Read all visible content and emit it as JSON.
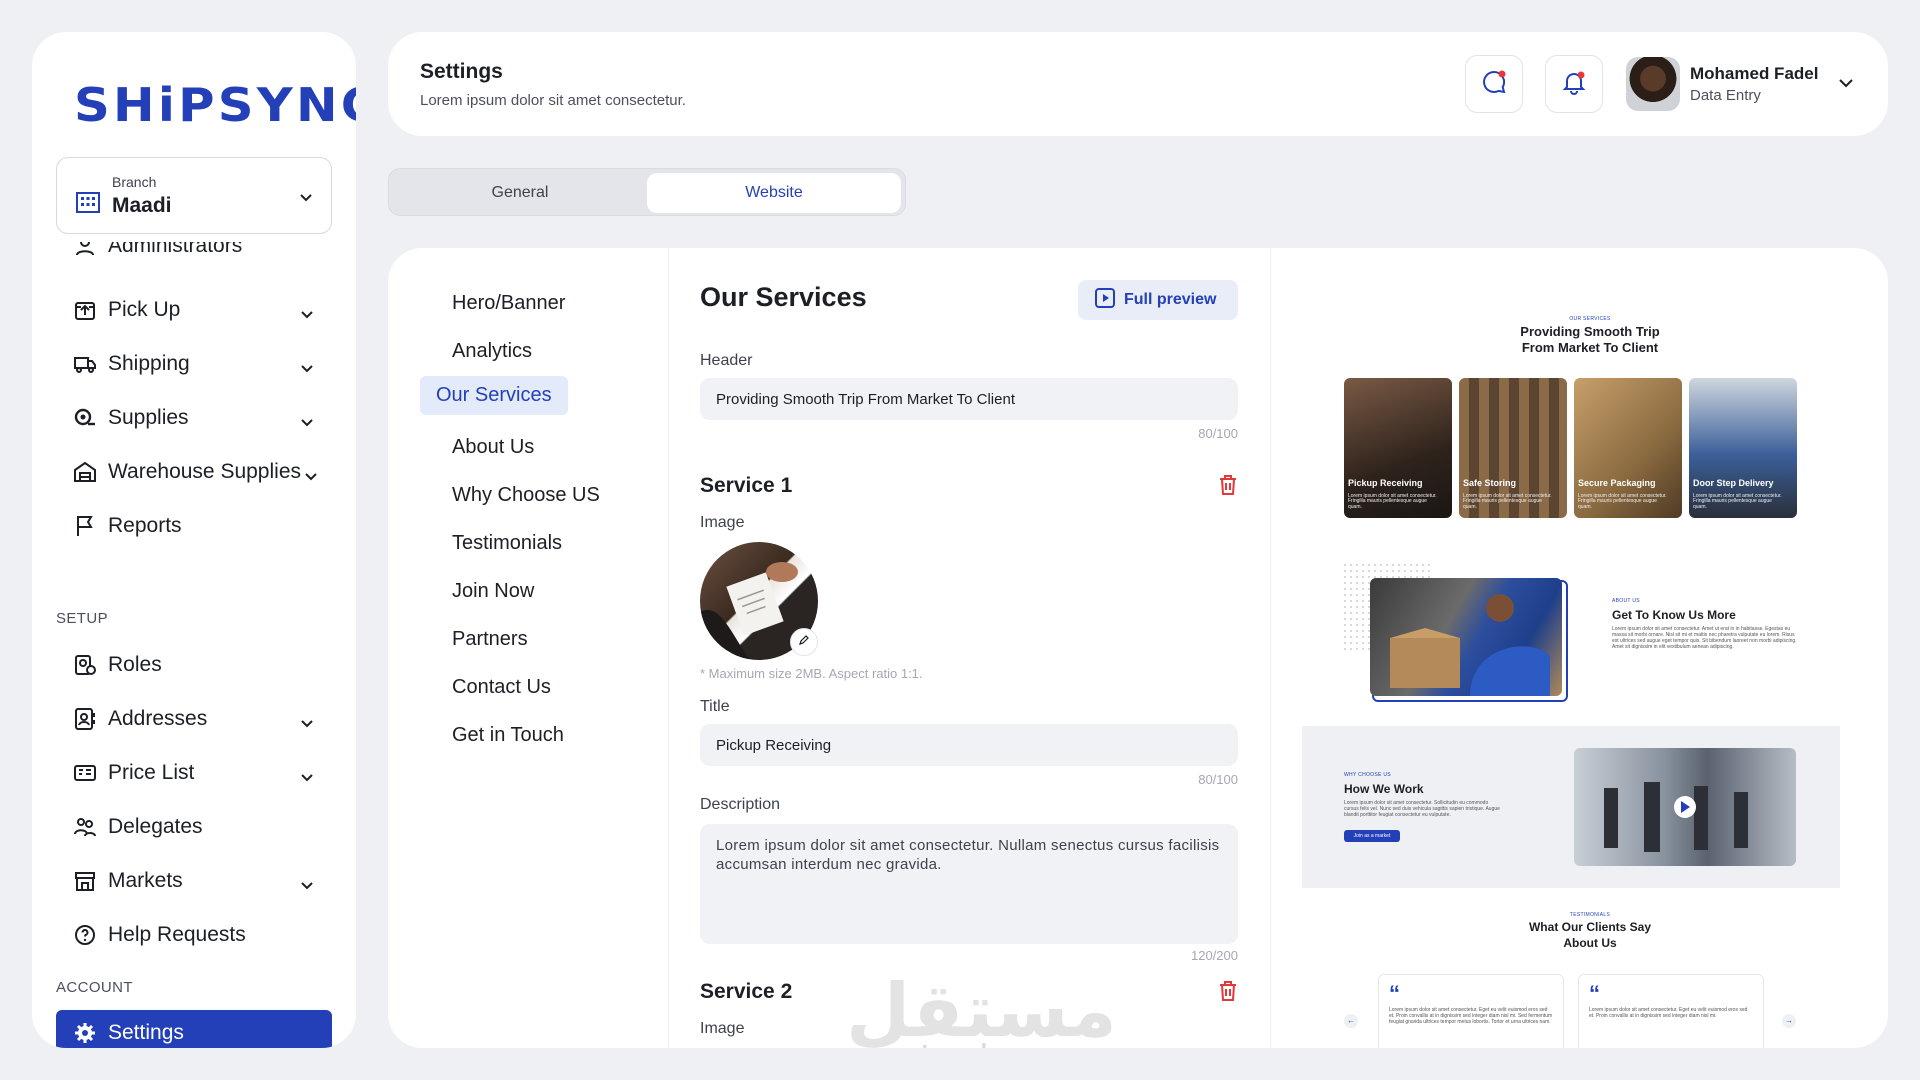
{
  "brand": {
    "logo": "SHiPSYNC",
    "accent": "#2440b8"
  },
  "branch": {
    "label": "Branch",
    "value": "Maadi"
  },
  "sidebar": {
    "partial_item": "Administrators",
    "items": [
      {
        "label": "Pick Up",
        "icon": "pickup-icon",
        "chevron": true
      },
      {
        "label": "Shipping",
        "icon": "truck-icon",
        "chevron": true
      },
      {
        "label": "Supplies",
        "icon": "supplies-icon",
        "chevron": true
      },
      {
        "label": "Warehouse Supplies",
        "icon": "warehouse-icon",
        "chevron": true
      },
      {
        "label": "Reports",
        "icon": "flag-icon",
        "chevron": false
      }
    ],
    "setup_label": "SETUP",
    "setup_items": [
      {
        "label": "Roles",
        "icon": "roles-icon",
        "chevron": false
      },
      {
        "label": "Addresses",
        "icon": "addresses-icon",
        "chevron": true
      },
      {
        "label": "Price List",
        "icon": "price-list-icon",
        "chevron": true
      },
      {
        "label": "Delegates",
        "icon": "delegates-icon",
        "chevron": false
      },
      {
        "label": "Markets",
        "icon": "markets-icon",
        "chevron": true
      },
      {
        "label": "Help Requests",
        "icon": "help-icon",
        "chevron": false
      }
    ],
    "account_label": "ACCOUNT",
    "settings_label": "Settings"
  },
  "header": {
    "title": "Settings",
    "subtitle": "Lorem ipsum dolor sit amet consectetur.",
    "user_name": "Mohamed Fadel",
    "user_role": "Data Entry"
  },
  "tabs": {
    "general": "General",
    "website": "Website",
    "active": "Website"
  },
  "section_menu": [
    "Hero/Banner",
    "Analytics",
    "Our Services",
    "About Us",
    "Why Choose US",
    "Testimonials",
    "Join Now",
    "Partners",
    "Contact Us",
    "Get in Touch"
  ],
  "section_menu_active": "Our Services",
  "form": {
    "title": "Our Services",
    "full_preview": "Full preview",
    "header_label": "Header",
    "header_value": "Providing Smooth Trip From Market To Client",
    "header_count": "80/100",
    "service1": {
      "heading": "Service 1",
      "image_label": "Image",
      "image_hint": "* Maximum size 2MB. Aspect ratio 1:1.",
      "title_label": "Title",
      "title_value": "Pickup Receiving",
      "title_count": "80/100",
      "desc_label": "Description",
      "desc_value": "Lorem ipsum dolor sit amet consectetur. Nullam senectus cursus facilisis accumsan interdum nec gravida.",
      "desc_count": "120/200"
    },
    "service2": {
      "heading": "Service 2",
      "image_label": "Image"
    }
  },
  "preview": {
    "services_tag": "OUR SERVICES",
    "services_title_1": "Providing Smooth Trip",
    "services_title_2": "From Market To Client",
    "cards": [
      {
        "title": "Pickup Receiving",
        "body": "Lorem ipsum dolor sit amet consectetur. Fringilla mauris pellentesque augue quam."
      },
      {
        "title": "Safe Storing",
        "body": "Lorem ipsum dolor sit amet consectetur. Fringilla mauris pellentesque augue quam."
      },
      {
        "title": "Secure Packaging",
        "body": "Lorem ipsum dolor sit amet consectetur. Fringilla mauris pellentesque augue quam."
      },
      {
        "title": "Door Step Delivery",
        "body": "Lorem ipsum dolor sit amet consectetur. Fringilla mauris pellentesque augue quam."
      }
    ],
    "about_tag": "ABOUT US",
    "about_title": "Get To Know Us More",
    "about_body": "Lorem ipsum dolor sit amet consectetur. Amet ut erat in in habitasse. Egestas eu massa sit morbi ornare. Nisl sit mi et mattis nec pharetra vulputate eu lorem. Risus est ultrices sed augue eget tempor quis. Sit bibendum laoreet non morbi adipiscing. Amet sit dignissim in elit vestibulum aenean adipiscing.",
    "why_tag": "WHY CHOOSE US",
    "why_title": "How We Work",
    "why_body": "Lorem ipsum dolor sit amet consectetur. Sollicitudin eu commodo cursus felis vel. Nunc sed duis vehicula sagittis sapien tristique. Augue blandit porttitor feugiat consectetur eu vulputate.",
    "why_button": "Join as a market",
    "testimonials_tag": "TESTIMONIALS",
    "testimonials_title_1": "What Our Clients Say",
    "testimonials_title_2": "About Us",
    "testimonial_body": "Lorem ipsum dolor sit amet consectetur. Eget eu velit euismod eros sed et. Proin convallis at in dignissim sed integer diam nisl mi. Sed fermentum feugiat gravida ultrices tempor metus lobortis. Tortor et urna ultrices nam.",
    "testimonial_body_2": "Lorem ipsum dolor sit amet consectetur. Eget eu velit euismod eros sed et. Proin convallis at in dignissim sed integer diam nisl mi."
  },
  "watermark": {
    "arabic": "مستقل",
    "latin": "mostaql.com"
  }
}
